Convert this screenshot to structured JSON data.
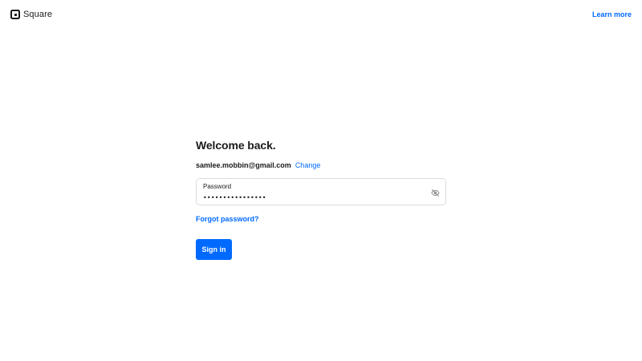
{
  "header": {
    "brand": "Square",
    "learn_more": "Learn more"
  },
  "form": {
    "title": "Welcome back.",
    "email": "samlee.mobbin@gmail.com",
    "change_label": "Change",
    "password": {
      "label": "Password",
      "value": "••••••••••••••••",
      "toggle_icon": "eye-slash-icon"
    },
    "forgot_label": "Forgot password?",
    "signin_label": "Sign in"
  },
  "colors": {
    "accent": "#006aff",
    "text": "#1a1a1a",
    "border": "#dcdcdc",
    "background": "#ffffff"
  }
}
